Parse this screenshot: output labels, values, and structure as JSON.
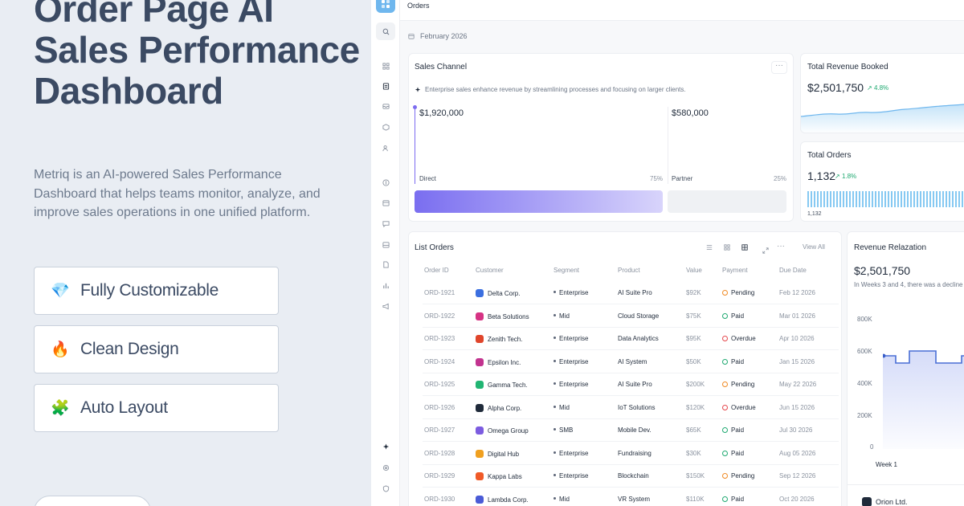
{
  "hero": {
    "title": "Order Page AI Sales Performance Dashboard",
    "description": "Metriq is an AI-powered Sales Performance Dashboard that helps teams monitor, analyze, and improve sales operations in one unified platform.",
    "features": [
      {
        "emoji": "💎",
        "label": "Fully Customizable"
      },
      {
        "emoji": "🔥",
        "label": "Clean Design"
      },
      {
        "emoji": "🧩",
        "label": "Auto Layout"
      }
    ]
  },
  "app": {
    "page_title": "Orders",
    "date": "February 2026",
    "sales_channel": {
      "title": "Sales Channel",
      "more": "···",
      "note": "Enterprise sales enhance revenue by streamlining processes and focusing on larger clients.",
      "direct": {
        "value": "$1,920,000",
        "label": "Direct",
        "pct": "75%"
      },
      "partner": {
        "value": "$580,000",
        "label": "Partner",
        "pct": "25%"
      }
    },
    "total_revenue": {
      "title": "Total Revenue Booked",
      "value": "$2,501,750",
      "change": "4.8%"
    },
    "total_orders": {
      "title": "Total Orders",
      "value": "1,132",
      "change": "1.8%",
      "foot": "1,132",
      "foot_right": "/"
    },
    "list_orders": {
      "title": "List Orders",
      "more": "···",
      "view_all": "View All",
      "columns": [
        "Order ID",
        "Customer",
        "Segment",
        "Product",
        "Value",
        "Payment",
        "Due Date"
      ],
      "rows": [
        {
          "id": "ORD-1921",
          "customer": "Delta Corp.",
          "segment": "Enterprise",
          "product": "AI Suite Pro",
          "value": "$92K",
          "payment": "Pending",
          "due": "Feb 12 2026",
          "logo": "#3b6fe0"
        },
        {
          "id": "ORD-1922",
          "customer": "Beta Solutions",
          "segment": "Mid",
          "product": "Cloud Storage",
          "value": "$75K",
          "payment": "Paid",
          "due": "Mar 01 2026",
          "logo": "#d63384"
        },
        {
          "id": "ORD-1923",
          "customer": "Zenith Tech.",
          "segment": "Enterprise",
          "product": "Data Analytics",
          "value": "$95K",
          "payment": "Overdue",
          "due": "Apr 10 2026",
          "logo": "#e0452b"
        },
        {
          "id": "ORD-1924",
          "customer": "Epsilon Inc.",
          "segment": "Enterprise",
          "product": "AI System",
          "value": "$50K",
          "payment": "Paid",
          "due": "Jan 15 2026",
          "logo": "#c2338f"
        },
        {
          "id": "ORD-1925",
          "customer": "Gamma Tech.",
          "segment": "Enterprise",
          "product": "AI Suite Pro",
          "value": "$200K",
          "payment": "Pending",
          "due": "May 22 2026",
          "logo": "#22b573"
        },
        {
          "id": "ORD-1926",
          "customer": "Alpha Corp.",
          "segment": "Mid",
          "product": "IoT Solutions",
          "value": "$120K",
          "payment": "Overdue",
          "due": "Jun 15 2026",
          "logo": "#1f2a3a"
        },
        {
          "id": "ORD-1927",
          "customer": "Omega Group",
          "segment": "SMB",
          "product": "Mobile Dev.",
          "value": "$65K",
          "payment": "Paid",
          "due": "Jul 30 2026",
          "logo": "#7c5ce0"
        },
        {
          "id": "ORD-1928",
          "customer": "Digital Hub",
          "segment": "Enterprise",
          "product": "Fundraising",
          "value": "$30K",
          "payment": "Paid",
          "due": "Aug 05 2026",
          "logo": "#f0a020"
        },
        {
          "id": "ORD-1929",
          "customer": "Kappa Labs",
          "segment": "Enterprise",
          "product": "Blockchain",
          "value": "$150K",
          "payment": "Pending",
          "due": "Sep 12 2026",
          "logo": "#f05a28"
        },
        {
          "id": "ORD-1930",
          "customer": "Lambda Corp.",
          "segment": "Mid",
          "product": "VR System",
          "value": "$110K",
          "payment": "Paid",
          "due": "Oct 20 2026",
          "logo": "#4a5bd6"
        }
      ]
    },
    "revenue_realization": {
      "title": "Revenue Relazation",
      "value": "$2,501,750",
      "note": "In Weeks 3 and 4, there was a decline",
      "y_ticks": [
        "800K",
        "600K",
        "400K",
        "200K",
        "0"
      ],
      "x_label": "Week 1",
      "client": "Orion Ltd."
    },
    "colors": {
      "pending": "#f08a24",
      "paid": "#1fa971",
      "overdue": "#e5484d",
      "accent": "#7c6cf0",
      "up": "#1fa971"
    }
  }
}
